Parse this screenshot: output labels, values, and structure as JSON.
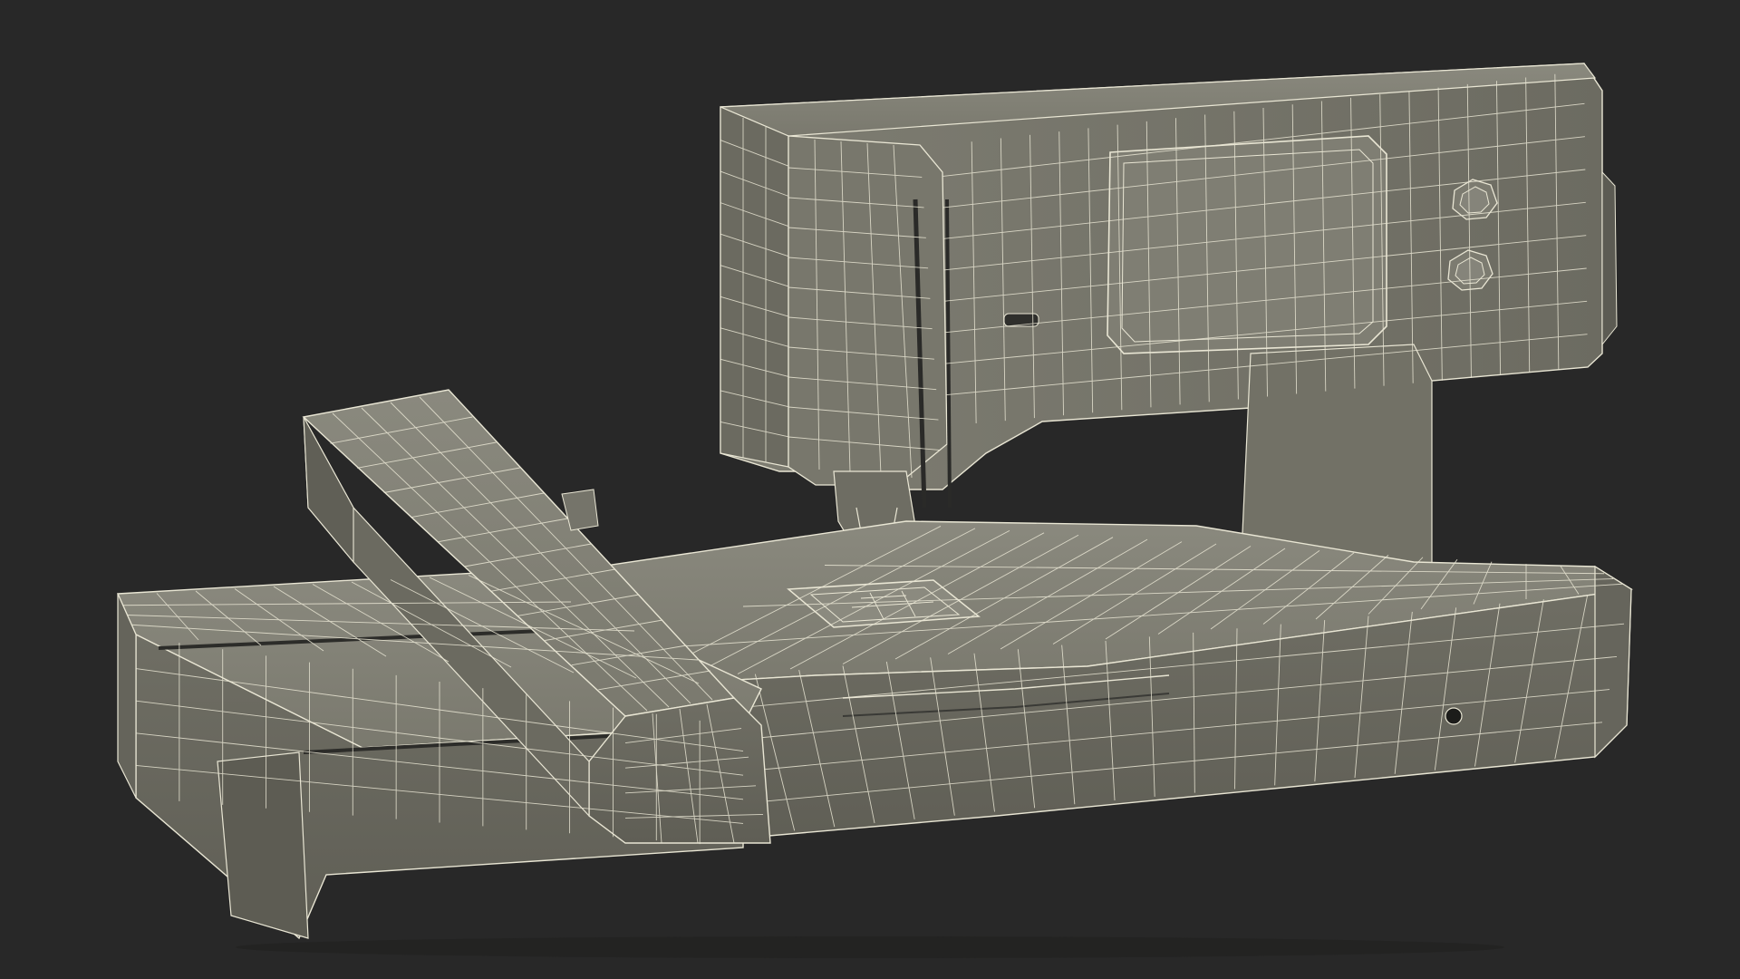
{
  "scene": {
    "subject": "sewing-machine-with-embroidery-unit",
    "render_style": "wireframe-over-shaded",
    "colors": {
      "background": "#282828",
      "surface": "#7b7a6f",
      "surface_light": "#8a897e",
      "surface_dark": "#5f5e55",
      "wire": "#e9e6d4",
      "shadow": "#1e1e1c"
    },
    "icons": [
      "upper-knob-icon",
      "lower-knob-icon"
    ]
  }
}
